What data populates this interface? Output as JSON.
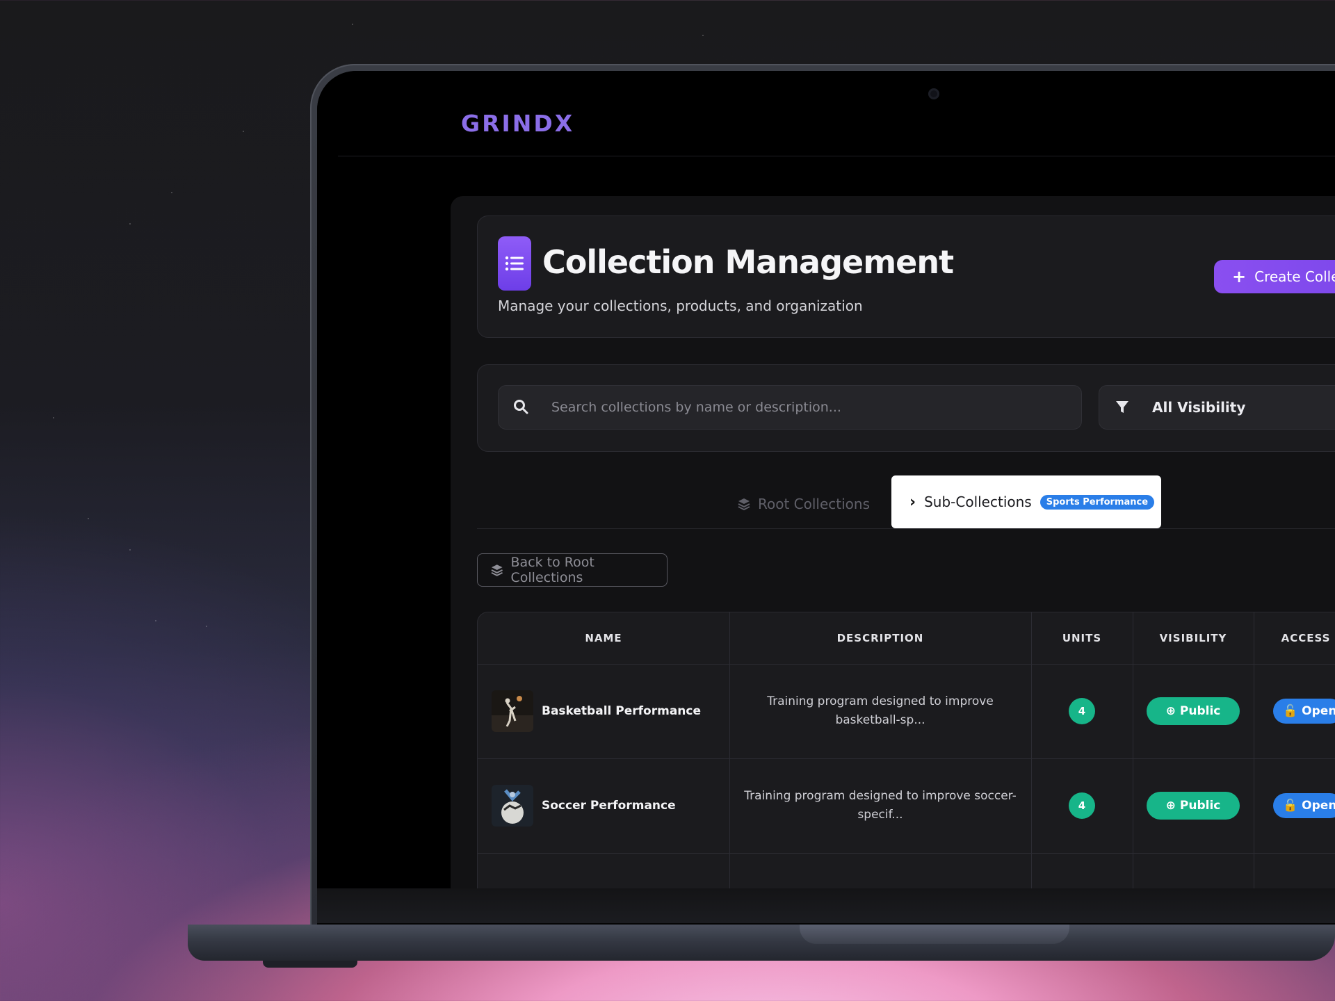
{
  "app": {
    "logo": "GRINDX"
  },
  "header": {
    "title": "Collection Management",
    "subtitle": "Manage your collections, products, and organization",
    "create_label": "Create Colle"
  },
  "search": {
    "placeholder": "Search collections by name or description..."
  },
  "filter": {
    "value": "All Visibility"
  },
  "tabs": {
    "root_label": "Root Collections",
    "sub_label": "Sub-Collections",
    "sub_badge": "Sports Performance"
  },
  "back_label": "Back to Root Collections",
  "table": {
    "headers": {
      "name": "NAME",
      "description": "DESCRIPTION",
      "units": "UNITS",
      "visibility": "VISIBILITY",
      "access": "ACCESS"
    },
    "rows": [
      {
        "name": "Basketball Performance",
        "description_line1": "Training program designed to improve",
        "description_line2": "basketball-sp...",
        "units": "4",
        "visibility": "Public",
        "access": "Open"
      },
      {
        "name": "Soccer Performance",
        "description_line1": "Training program designed to improve soccer-",
        "description_line2": "specif...",
        "units": "4",
        "visibility": "Public",
        "access": "Open"
      }
    ]
  },
  "colors": {
    "accent": "#7a46ea",
    "success": "#17b589",
    "info": "#2a7ee8",
    "logo": "#8b6ee8"
  }
}
